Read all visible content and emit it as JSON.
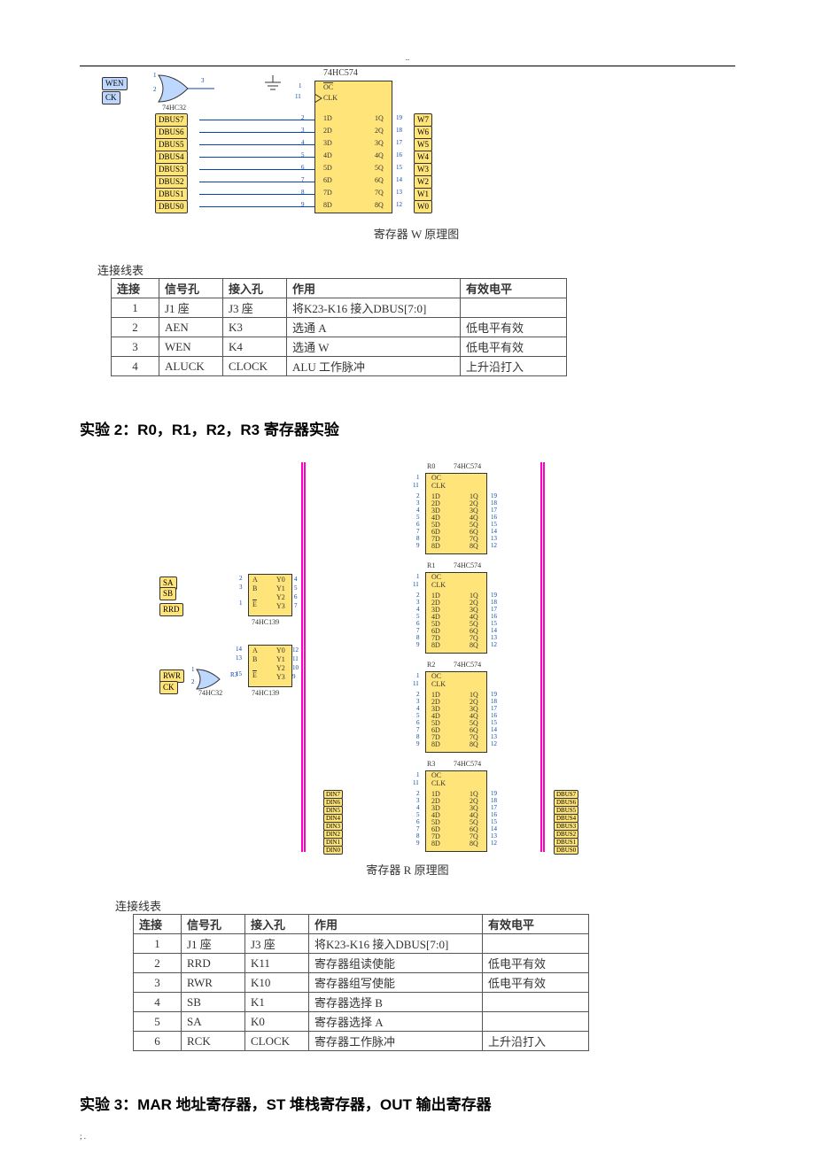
{
  "header_dots": "..",
  "footer_dots": ";  .",
  "diagram_w": {
    "gate_inputs": [
      "WEN",
      "CK"
    ],
    "gate_chip": "74HC32",
    "gate_pin_left1": "1",
    "gate_pin_left2": "2",
    "gate_pin_out": "3",
    "register_label": "74HC574",
    "oc_pin": "1",
    "clk_pin": "11",
    "oc_text": "OC",
    "clk_text": "CLK",
    "dbus": [
      "DBUS7",
      "DBUS6",
      "DBUS5",
      "DBUS4",
      "DBUS3",
      "DBUS2",
      "DBUS1",
      "DBUS0"
    ],
    "d_pins_num": [
      "2",
      "3",
      "4",
      "5",
      "6",
      "7",
      "8",
      "9"
    ],
    "d_pins": [
      "1D",
      "2D",
      "3D",
      "4D",
      "5D",
      "6D",
      "7D",
      "8D"
    ],
    "q_pins": [
      "1Q",
      "2Q",
      "3Q",
      "4Q",
      "5Q",
      "6Q",
      "7Q",
      "8Q"
    ],
    "q_pins_num": [
      "19",
      "18",
      "17",
      "16",
      "15",
      "14",
      "13",
      "12"
    ],
    "w_out": [
      "W7",
      "W6",
      "W5",
      "W4",
      "W3",
      "W2",
      "W1",
      "W0"
    ],
    "caption": "寄存器 W 原理图"
  },
  "table1": {
    "title": "连接线表",
    "headers": [
      "连接",
      "信号孔",
      "接入孔",
      "作用",
      "有效电平"
    ],
    "rows": [
      [
        "1",
        "J1 座",
        "J3 座",
        "将K23-K16 接入DBUS[7:0]",
        ""
      ],
      [
        "2",
        "AEN",
        "K3",
        "选通 A",
        "低电平有效"
      ],
      [
        "3",
        "WEN",
        "K4",
        "选通 W",
        "低电平有效"
      ],
      [
        "4",
        "ALUCK",
        "CLOCK",
        "ALU 工作脉冲",
        "上升沿打入"
      ]
    ]
  },
  "exp2_heading": "实验  2：R0，R1，R2，R3 寄存器实验",
  "diagram_r": {
    "inputs_left": [
      "SA",
      "SB",
      "RRD",
      "RWR",
      "CK"
    ],
    "decoder": "74HC139",
    "decoder_pins_a": {
      "A": "2",
      "B": "3",
      "E": "1"
    },
    "decoder_outs_a": [
      "Y0",
      "Y1",
      "Y2",
      "Y3"
    ],
    "decoder_out_pins_a": [
      "4",
      "5",
      "6",
      "7"
    ],
    "decoder_pins_b": {
      "A": "14",
      "B": "13",
      "E": "15"
    },
    "decoder_outs_b": [
      "Y0",
      "Y1",
      "Y2",
      "Y3"
    ],
    "decoder_out_pins_b": [
      "12",
      "11",
      "10",
      "9"
    ],
    "gate": "74HC32",
    "gate_pin1": "1",
    "gate_pin2": "2",
    "gate_out": "R3",
    "registers": [
      "R0",
      "R1",
      "R2",
      "R3"
    ],
    "reg_chip": "74HC574",
    "reg_oc": "OC",
    "reg_clk": "CLK",
    "reg_oc_pin": "1",
    "reg_clk_pin": "11",
    "reg_d": [
      "1D",
      "2D",
      "3D",
      "4D",
      "5D",
      "6D",
      "7D",
      "8D"
    ],
    "reg_d_num": [
      "2",
      "3",
      "4",
      "5",
      "6",
      "7",
      "8",
      "9"
    ],
    "reg_q": [
      "1Q",
      "2Q",
      "3Q",
      "4Q",
      "5Q",
      "6Q",
      "7Q",
      "8Q"
    ],
    "reg_q_num": [
      "19",
      "18",
      "17",
      "16",
      "15",
      "14",
      "13",
      "12"
    ],
    "din": [
      "DIN7",
      "DIN6",
      "DIN5",
      "DIN4",
      "DIN3",
      "DIN2",
      "DIN1",
      "DIN0"
    ],
    "dbus_out": [
      "DBUS7",
      "DBUS6",
      "DBUS5",
      "DBUS4",
      "DBUS3",
      "DBUS2",
      "DBUS1",
      "DBUS0"
    ],
    "caption": "寄存器 R 原理图"
  },
  "table2": {
    "title": "连接线表",
    "headers": [
      "连接",
      "信号孔",
      "接入孔",
      "作用",
      "有效电平"
    ],
    "rows": [
      [
        "1",
        "J1 座",
        "J3 座",
        "将K23-K16 接入DBUS[7:0]",
        ""
      ],
      [
        "2",
        "RRD",
        "K11",
        "寄存器组读使能",
        "低电平有效"
      ],
      [
        "3",
        "RWR",
        "K10",
        "寄存器组写使能",
        "低电平有效"
      ],
      [
        "4",
        "SB",
        "K1",
        "寄存器选择 B",
        ""
      ],
      [
        "5",
        "SA",
        "K0",
        "寄存器选择 A",
        ""
      ],
      [
        "6",
        "RCK",
        "CLOCK",
        "寄存器工作脉冲",
        "上升沿打入"
      ]
    ]
  },
  "exp3_heading": "实验  3：MAR 地址寄存器，ST  堆栈寄存器，OUT 输出寄存器"
}
